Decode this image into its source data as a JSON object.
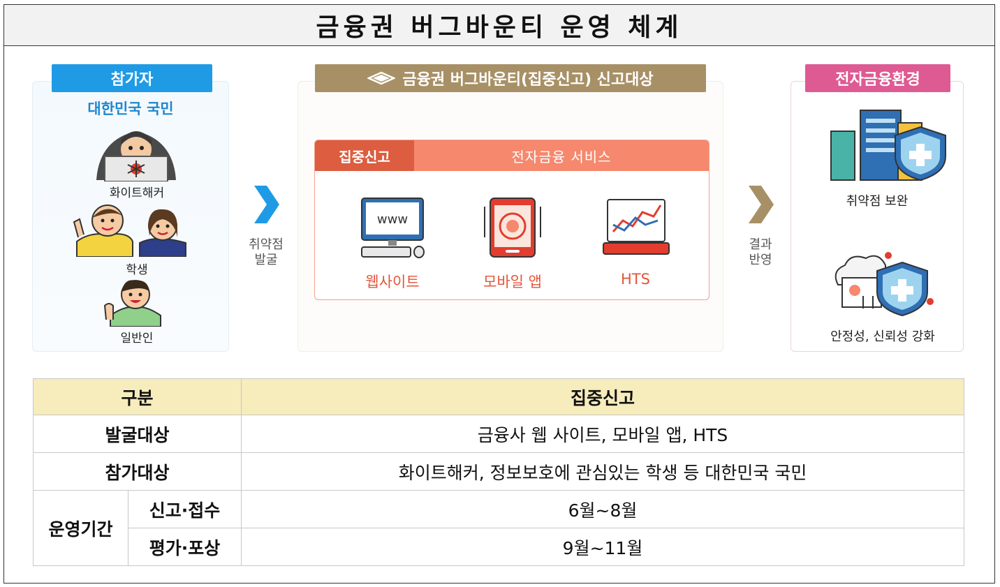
{
  "title": "금융권 버그바운티 운영 체계",
  "participants": {
    "tag": "참가자",
    "subtitle": "대한민국 국민",
    "items": [
      "화이트해커",
      "학생",
      "일반인"
    ]
  },
  "arrow_discover": {
    "line1": "취약점",
    "line2": "발굴"
  },
  "target": {
    "tag": "금융권 버그바운티(집중신고) 신고대상",
    "box_label": "집중신고",
    "box_title": "전자금융 서비스",
    "services": [
      "웹사이트",
      "모바일 앱",
      "HTS"
    ],
    "www_text": "www"
  },
  "arrow_result": {
    "line1": "결과",
    "line2": "반영"
  },
  "environment": {
    "tag": "전자금융환경",
    "items": [
      "취약점 보완",
      "안정성, 신뢰성 강화"
    ]
  },
  "table": {
    "header": [
      "구분",
      "집중신고"
    ],
    "rows": [
      {
        "label": "발굴대상",
        "value": "금융사 웹 사이트, 모바일 앱, HTS"
      },
      {
        "label": "참가대상",
        "value": "화이트해커, 정보보호에 관심있는 학생 등 대한민국 국민"
      }
    ],
    "period": {
      "label": "운영기간",
      "sub": [
        {
          "label": "신고·접수",
          "value": "6월~8월"
        },
        {
          "label": "평가·포상",
          "value": "9월~11월"
        }
      ]
    }
  },
  "colors": {
    "blue": "#1f9be6",
    "brown": "#a89066",
    "pink": "#de5a93",
    "orange": "#f6886d",
    "dark_orange": "#dc5d3f",
    "table_header": "#f7ecbc"
  }
}
